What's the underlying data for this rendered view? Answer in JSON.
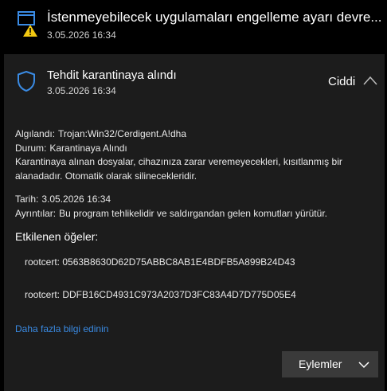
{
  "top_notification": {
    "title": "İstenmeyebilecek uygulamaları engelleme ayarı devre...",
    "date": "3.05.2026 16:34",
    "icon": "app-window-warning-icon"
  },
  "threat_card": {
    "title": "Tehdit karantinaya alındı",
    "date": "3.05.2026 16:34",
    "severity": "Ciddi",
    "icon": "shield-icon",
    "detected_label": "Algılandı:",
    "detected_value": "Trojan:Win32/Cerdigent.A!dha",
    "status_label": "Durum:",
    "status_value": "Karantinaya Alındı",
    "description_line1": "Karantinaya alınan dosyalar, cihazınıza zarar veremeyecekleri, kısıtlanmış bir",
    "description_line2": "alanadadır. Otomatik olarak silinecekleridir.",
    "date_label": "Tarih:",
    "date_value": "3.05.2026 16:34",
    "details_label": "Ayrıntılar:",
    "details_value": "Bu program tehlikelidir ve saldırgandan gelen komutları yürütür.",
    "affected_heading": "Etkilenen öğeler:",
    "affected_items": [
      "rootcert: 0563B8630D62D75ABBC8AB1E4BDFB5A899B24D43",
      "rootcert: DDFB16CD4931C973A2037D3FC83A4D7D775D05E4"
    ],
    "learn_more": "Daha fazla bilgi edinin",
    "actions_label": "Eylemler"
  },
  "colors": {
    "background": "#000000",
    "card": "#1c1c1c",
    "accent_link": "#3a8be4",
    "warning": "#f2c811",
    "button": "#3a3a3a"
  }
}
